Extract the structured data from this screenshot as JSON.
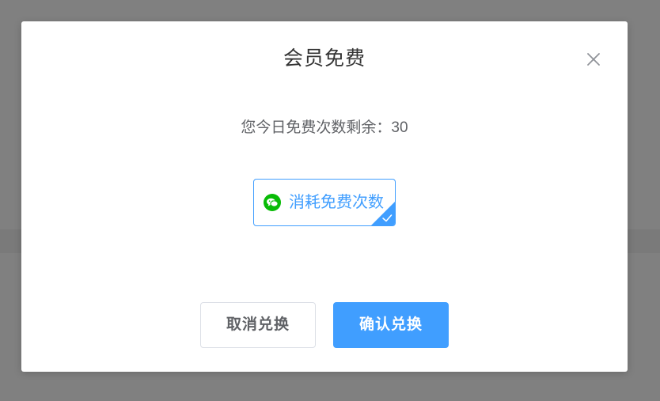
{
  "dialog": {
    "title": "会员免费",
    "close_icon": "close-icon",
    "remaining_text": "您今日免费次数剩余：30",
    "option": {
      "label": "消耗免费次数",
      "icon": "wechat-icon",
      "selected": true
    },
    "buttons": {
      "cancel_label": "取消兑换",
      "confirm_label": "确认兑换"
    }
  },
  "colors": {
    "overlay": "#808080",
    "accent": "#409eff",
    "wechat_green": "#09bb07",
    "title_text": "#333333",
    "body_text": "#606266"
  }
}
